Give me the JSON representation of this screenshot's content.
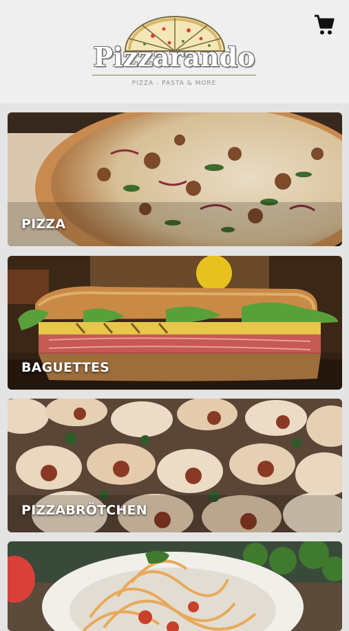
{
  "header": {
    "logo_title": "Pizzarando",
    "logo_subtitle": "PIZZA - PASTA & MORE",
    "cart_icon": "shopping-cart-icon"
  },
  "categories": [
    {
      "label": "PIZZA",
      "image": "pizza-photo"
    },
    {
      "label": "BAGUETTES",
      "image": "baguette-sandwich-photo"
    },
    {
      "label": "PIZZABRÖTCHEN",
      "image": "pizza-rolls-photo"
    },
    {
      "label": "",
      "image": "spaghetti-photo"
    }
  ],
  "colors": {
    "header_bg": "#efefef",
    "page_bg": "#e4e4e4",
    "label_text": "#ffffff"
  }
}
